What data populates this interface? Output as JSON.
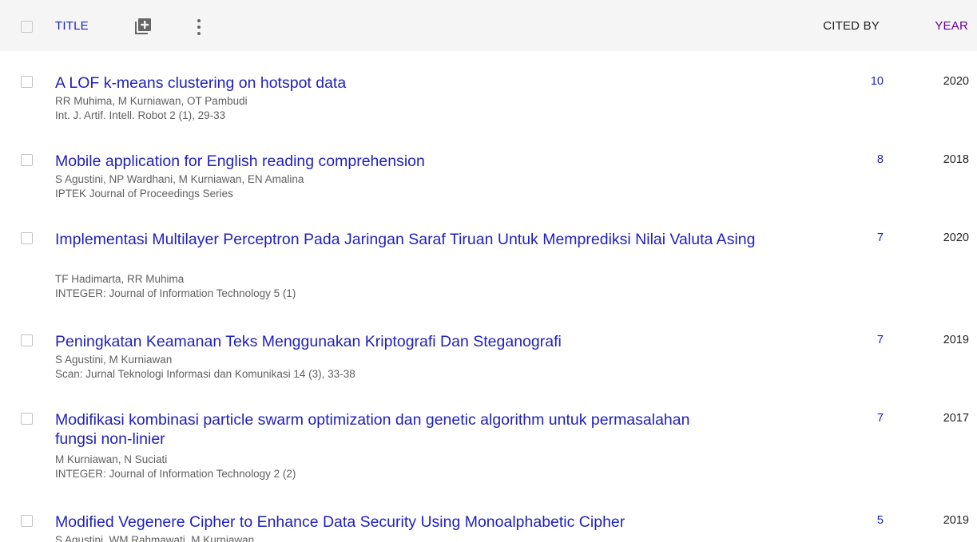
{
  "header": {
    "title_label": "TITLE",
    "cited_label": "CITED BY",
    "year_label": "YEAR",
    "add_icon": "add-box-icon",
    "more_icon": "vertical-dots-icon"
  },
  "colors": {
    "link": "#1f1fbf",
    "header_bg": "#f5f5f5",
    "year_header": "#660099",
    "meta_text": "#5f5f5f"
  },
  "articles": [
    {
      "title": "A LOF k-means clustering on hotspot data",
      "authors": "RR Muhima, M Kurniawan, OT Pambudi",
      "venue": "Int. J. Artif. Intell. Robot 2 (1), 29-33",
      "cited_by": "10",
      "year": "2020"
    },
    {
      "title": "Mobile application for English reading comprehension",
      "authors": "S Agustini, NP Wardhani, M Kurniawan, EN Amalina",
      "venue": "IPTEK Journal of Proceedings Series",
      "cited_by": "8",
      "year": "2018"
    },
    {
      "title": "Implementasi Multilayer Perceptron Pada Jaringan Saraf Tiruan Untuk Memprediksi Nilai Valuta Asing",
      "authors": "TF Hadimarta, RR Muhima",
      "venue": "INTEGER: Journal of Information Technology 5 (1)",
      "cited_by": "7",
      "year": "2020"
    },
    {
      "title": "Peningkatan Keamanan Teks Menggunakan Kriptografi Dan Steganografi",
      "authors": "S Agustini, M Kurniawan",
      "venue": "Scan: Jurnal Teknologi Informasi dan Komunikasi 14 (3), 33-38",
      "cited_by": "7",
      "year": "2019"
    },
    {
      "title": "Modifikasi kombinasi particle swarm optimization dan genetic algorithm untuk permasalahan fungsi non-linier",
      "authors": "M Kurniawan, N Suciati",
      "venue": "INTEGER: Journal of Information Technology 2 (2)",
      "cited_by": "7",
      "year": "2017"
    },
    {
      "title": "Modified Vegenere Cipher to Enhance Data Security Using Monoalphabetic Cipher",
      "authors": "S Agustini, WM Rahmawati, M Kurniawan",
      "venue": "",
      "cited_by": "5",
      "year": "2019"
    }
  ]
}
